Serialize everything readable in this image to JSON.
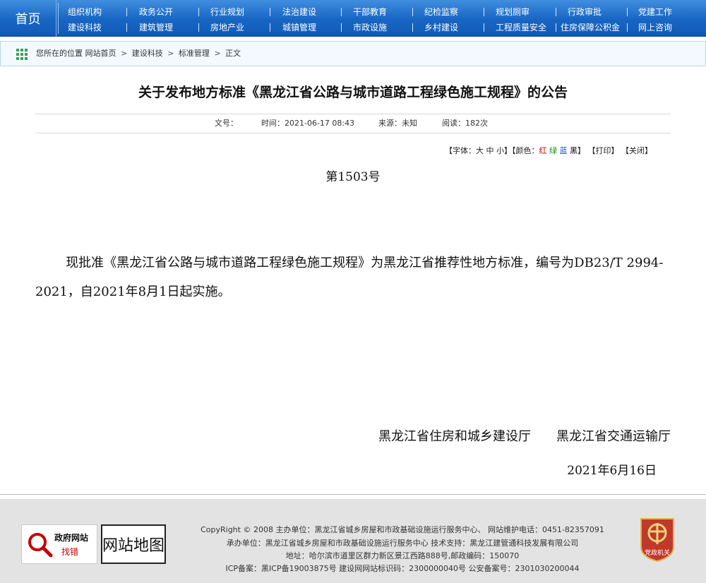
{
  "nav": {
    "home": "首页",
    "row1": [
      "组织机构",
      "政务公开",
      "行业规划",
      "法治建设",
      "干部教育",
      "纪检监察",
      "规划厕审",
      "行政审批",
      "党建工作"
    ],
    "row2": [
      "建设科技",
      "建筑管理",
      "房地产业",
      "城镇管理",
      "市政设施",
      "乡村建设",
      "工程质量安全",
      "住房保障公积金",
      "网上咨询"
    ]
  },
  "breadcrumb": {
    "prefix": "您所在的位置",
    "items": [
      "网站首页",
      "建设科技",
      "标准管理",
      "正文"
    ],
    "arrow": ">"
  },
  "article": {
    "title": "关于发布地方标准《黑龙江省公路与城市道路工程绿色施工规程》的公告",
    "meta": {
      "docno": "文号：",
      "time": "时间：2021-06-17 08:43",
      "source": "来源：未知",
      "views": "阅读：182次"
    },
    "tools": {
      "font_label": "【字体：",
      "font_large": "大",
      "font_medium": "中",
      "font_small": "小",
      "close_bracket": "】",
      "color_label": "【颜色：",
      "color_red": "红",
      "color_green": "绿",
      "color_blue": "蓝",
      "color_black": "黑",
      "print": "【打印】",
      "close": "【关闭】"
    },
    "number": "第1503号",
    "body": "现批准《黑龙江省公路与城市道路工程绿色施工规程》为黑龙江省推荐性地方标准，编号为DB23/T 2994-2021，自2021年8月1日起实施。",
    "signers": [
      "黑龙江省住房和城乡建设厅",
      "黑龙江省交通运输厅"
    ],
    "date": "2021年6月16日"
  },
  "footer": {
    "badge_error_title": "政府网站",
    "badge_error_sub": "找错",
    "badge_sitemap": "网站地图",
    "line1": "CopyRight © 2008 主办单位：黑龙江省城乡房屋和市政基础设施运行服务中心、  网站维护电话：0451-82357091",
    "line2": "承办单位：黑龙江省城乡房屋和市政基础设施运行服务中心  技术支持：黑龙江建管通科技发展有限公司",
    "line3": "地址：哈尔滨市道里区群力新区景江西路888号,邮政编码：150070",
    "line4": "ICP备案：黑ICP备19003875号   建设网网站标识码：2300000040号   公安备案号：2301030200044",
    "party_badge": "党政机关"
  },
  "colors": {
    "nav_blue": "#1866c4",
    "accent_red": "#c40000",
    "footer_bg": "#e3e3e3"
  }
}
